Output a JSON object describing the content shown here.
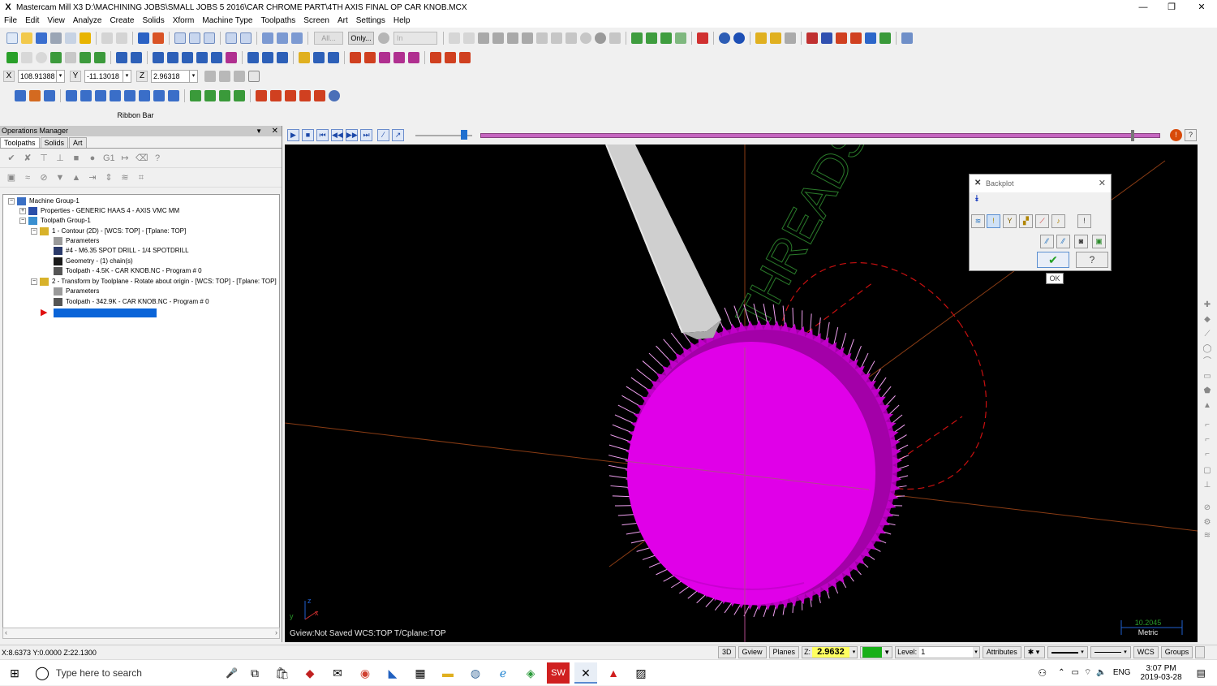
{
  "window": {
    "app_icon": "X",
    "title": "Mastercam Mill X3  D:\\MACHINING JOBS\\SMALL JOBS 5 2016\\CAR CHROME PART\\4TH AXIS FINAL OP CAR KNOB.MCX",
    "minimize": "—",
    "restore": "❐",
    "close": "✕"
  },
  "menu": [
    "File",
    "Edit",
    "View",
    "Analyze",
    "Create",
    "Solids",
    "Xform",
    "Machine Type",
    "Toolpaths",
    "Screen",
    "Art",
    "Settings",
    "Help"
  ],
  "toolbar1": {
    "all_label": "All...",
    "only_label": "Only...",
    "in_label": "In"
  },
  "coords": {
    "x_label": "X",
    "x_value": "108.91388",
    "y_label": "Y",
    "y_value": "-11.13018",
    "z_label": "Z",
    "z_value": "2.96318"
  },
  "ribbon_bar_label": "Ribbon Bar",
  "ops": {
    "title": "Operations Manager",
    "tabs": [
      "Toolpaths",
      "Solids",
      "Art"
    ],
    "tree": [
      "Machine Group-1",
      "Properties - GENERIC HAAS 4 - AXIS VMC MM",
      "Toolpath Group-1",
      "1 - Contour (2D) - [WCS: TOP] - [Tplane: TOP]",
      "Parameters",
      "#4 - M6.35 SPOT DRILL -  1/4 SPOTDRILL",
      "Geometry - (1) chain(s)",
      "Toolpath - 4.5K - CAR KNOB.NC - Program # 0",
      "2 - Transform by Toolplane - Rotate about origin - [WCS: TOP] - [Tplane: TOP]",
      "Parameters",
      "Toolpath - 342.9K - CAR KNOB.NC - Program # 0"
    ]
  },
  "viewport": {
    "status_text": "Gview:Not Saved   WCS:TOP   T/Cplane:TOP",
    "text_on_part": "THREADS 10",
    "scale_value": "10.2045",
    "scale_unit": "Metric",
    "triad_x": "x",
    "triad_y": "y",
    "triad_z": "z",
    "backplot_progress": 0.96
  },
  "backplot": {
    "title": "Backplot",
    "ok_tooltip": "OK"
  },
  "status": {
    "xyz": "X:8.6373   Y:0.0000  Z:22.1300",
    "buttons": [
      "3D",
      "Gview",
      "Planes"
    ],
    "z_label": "Z:",
    "z_value": "2.9632",
    "color_value": "2",
    "level_label": "Level:",
    "level_value": "1",
    "attributes": "Attributes",
    "wcs": "WCS",
    "groups": "Groups"
  },
  "taskbar": {
    "search_placeholder": "Type here to search",
    "lang": "ENG",
    "time": "3:07 PM",
    "date": "2019-03-28"
  },
  "colors": {
    "part_magenta": "#e000e8",
    "toolpath_red": "#c81010",
    "axis_brown": "#8a3c14",
    "text_green": "#2a7a2a",
    "tool_gray": "#cfcfcf"
  }
}
